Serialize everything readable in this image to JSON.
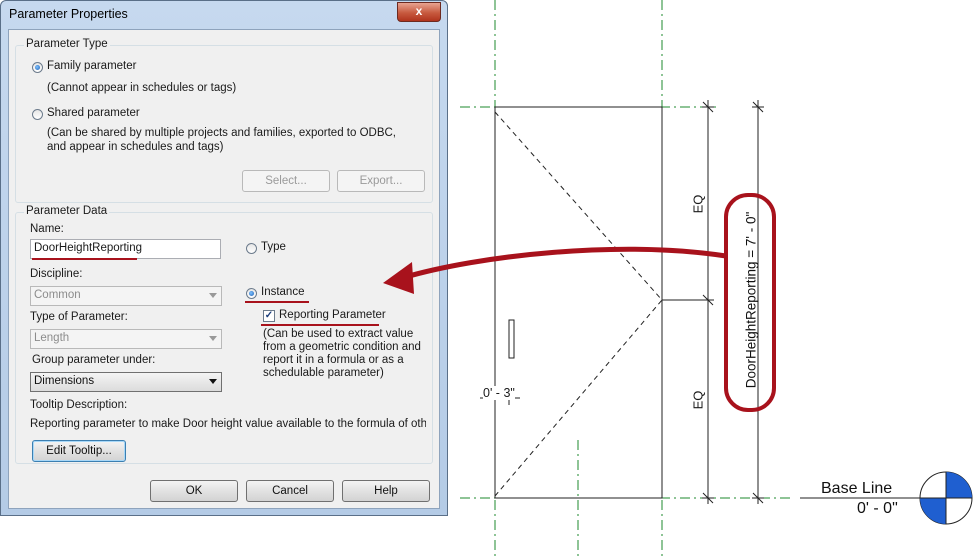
{
  "window": {
    "title": "Parameter Properties",
    "close_glyph": "x"
  },
  "parameter_type": {
    "group_label": "Parameter Type",
    "family_label": "Family parameter",
    "family_desc": "(Cannot appear in schedules or tags)",
    "shared_label": "Shared parameter",
    "shared_desc": "(Can be shared by multiple projects and families, exported to ODBC, and appear in schedules and tags)",
    "select_button": "Select...",
    "export_button": "Export...",
    "selected": "family"
  },
  "parameter_data": {
    "group_label": "Parameter Data",
    "name_label": "Name:",
    "name_value": "DoorHeightReporting",
    "type_label": "Type",
    "instance_label": "Instance",
    "selected": "instance",
    "discipline_label": "Discipline:",
    "discipline_value": "Common",
    "type_of_parameter_label": "Type of Parameter:",
    "type_of_parameter_value": "Length",
    "reporting_label": "Reporting Parameter",
    "reporting_checked": true,
    "reporting_desc": "(Can be used to extract value from a geometric condition and report it in a formula or as a schedulable parameter)",
    "group_under_label": "Group parameter under:",
    "group_under_value": "Dimensions",
    "tooltip_label": "Tooltip Description:",
    "tooltip_value": "Reporting parameter to make Door height value available to the formula of oth...",
    "edit_tooltip_button": "Edit Tooltip..."
  },
  "footer": {
    "ok_button": "OK",
    "cancel_button": "Cancel",
    "help_button": "Help"
  },
  "drawing": {
    "eq_upper": "EQ",
    "eq_lower": "EQ",
    "reporting_dimension": "DoorHeightReporting = 7' - 0\"",
    "small_dimension": "0' - 3\"",
    "level_name": "Base Line",
    "level_elevation": "0' - 0\"",
    "colors": {
      "annotation_red": "#a8121c",
      "reference_plane": "#1e8a2e",
      "level_blue": "#1f5fd0"
    }
  }
}
